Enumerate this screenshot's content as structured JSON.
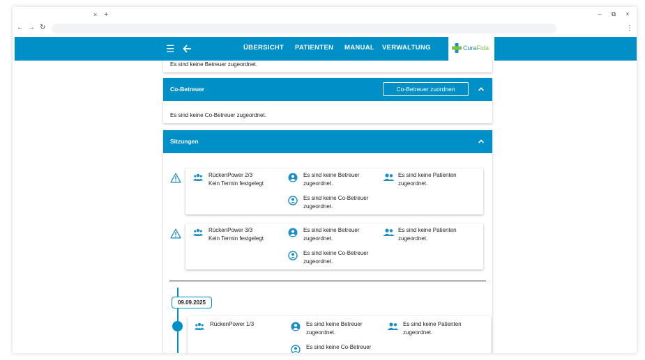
{
  "browser": {
    "tab_close": "×",
    "tab_new": "+",
    "win_min": "–",
    "win_max": "⧉",
    "win_close": "×",
    "back": "←",
    "forward": "→",
    "reload": "↻",
    "menu": "⋮"
  },
  "topbar": {
    "nav": [
      "ÜBERSICHT",
      "PATIENTEN",
      "MANUAL",
      "VERWALTUNG"
    ],
    "logo_a": "Cura",
    "logo_b": "Fida",
    "colors": {
      "primary": "#0090c8",
      "logo_green": "#7ec143"
    }
  },
  "betreuer_card": {
    "empty_text": "Es sind keine Betreuer zugeordnet."
  },
  "cobetreuer_card": {
    "title": "Co-Betreuer",
    "assign_button": "Co-Betreuer zuordnen",
    "empty_text": "Es sind keine Co-Betreuer zugeordnet."
  },
  "sitzungen_card": {
    "title": "Sitzungen",
    "sessions": [
      {
        "name": "RückenPower 2/3",
        "termin": "Kein Termin festgelegt",
        "betreuer_1": "Es sind keine Betreuer",
        "betreuer_2": "zugeordnet.",
        "cobetreuer_1": "Es sind keine Co-Betreuer",
        "cobetreuer_2": "zugeordnet.",
        "patienten_1": "Es sind keine Patienten",
        "patienten_2": "zugeordnet."
      },
      {
        "name": "RückenPower 3/3",
        "termin": "Kein Termin festgelegt",
        "betreuer_1": "Es sind keine Betreuer",
        "betreuer_2": "zugeordnet.",
        "cobetreuer_1": "Es sind keine Co-Betreuer",
        "cobetreuer_2": "zugeordnet.",
        "patienten_1": "Es sind keine Patienten",
        "patienten_2": "zugeordnet."
      }
    ],
    "timeline": {
      "date": "09.09.2025",
      "session": {
        "name": "RückenPower 1/3",
        "betreuer_1": "Es sind keine Betreuer",
        "betreuer_2": "zugeordnet.",
        "cobetreuer_1": "Es sind keine Co-Betreuer",
        "patienten_1": "Es sind keine Patienten",
        "patienten_2": "zugeordnet."
      }
    }
  }
}
